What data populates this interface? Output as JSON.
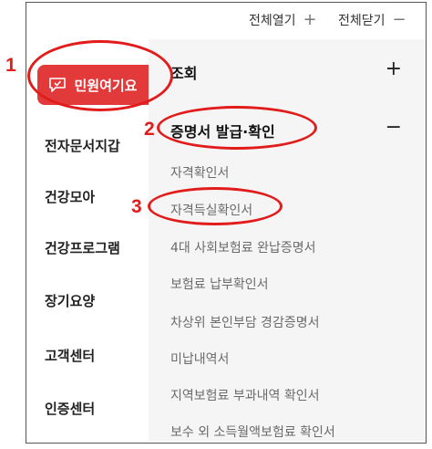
{
  "topbar": {
    "expand_all": "전체열기",
    "collapse_all": "전체닫기"
  },
  "sidebar": {
    "primary": "민원여기요",
    "items": [
      "전자문서지갑",
      "건강모아",
      "건강프로그램",
      "장기요양",
      "고객센터",
      "인증센터"
    ]
  },
  "content": {
    "sections": [
      {
        "title": "조회",
        "toggle": "+"
      },
      {
        "title": "증명서 발급·확인",
        "toggle": "−"
      }
    ],
    "links": [
      "자격확인서",
      "자격득실확인서",
      "4대 사회보험료 완납증명서",
      "보험료 납부확인서",
      "차상위 본인부담 경감증명서",
      "미납내역서",
      "지역보험료 부과내역 확인서",
      "보수 외 소득월액보험료 확인서"
    ]
  },
  "annotations": [
    "1",
    "2",
    "3"
  ],
  "colors": {
    "accent": "#e23a3a",
    "annotation": "#e21b1b",
    "content_bg": "#f5f5f6"
  }
}
